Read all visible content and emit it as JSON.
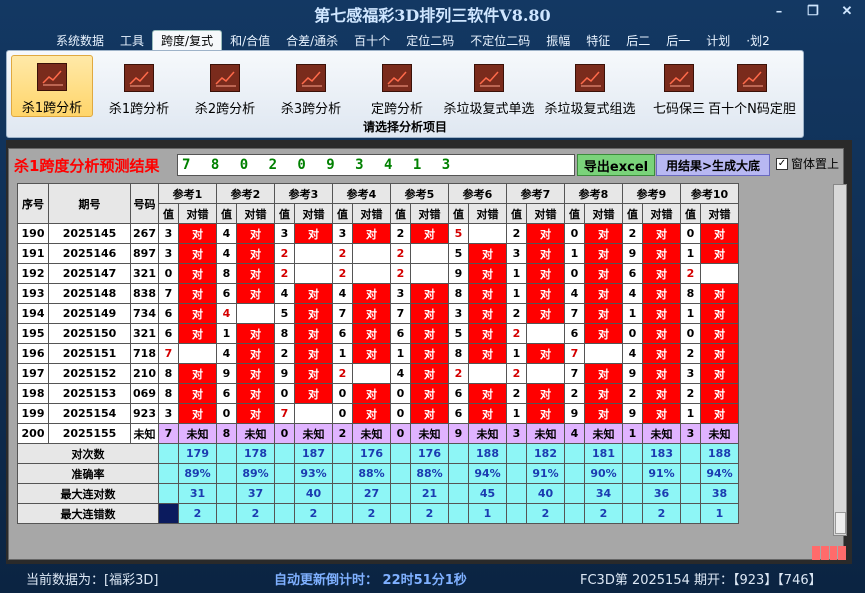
{
  "window": {
    "title": "第七感福彩3D排列三软件V8.80",
    "btn_min": "–",
    "btn_max": "❐",
    "btn_close": "✕"
  },
  "menu": [
    {
      "label": "系统数据",
      "active": false
    },
    {
      "label": "工具",
      "active": false
    },
    {
      "label": "跨度/复式",
      "active": true
    },
    {
      "label": "和/合值",
      "active": false
    },
    {
      "label": "合差/通杀",
      "active": false
    },
    {
      "label": "百十个",
      "active": false
    },
    {
      "label": "定位二码",
      "active": false
    },
    {
      "label": "不定位二码",
      "active": false
    },
    {
      "label": "振幅",
      "active": false
    },
    {
      "label": "特征",
      "active": false
    },
    {
      "label": "后二",
      "active": false
    },
    {
      "label": "后一",
      "active": false
    },
    {
      "label": "计划",
      "active": false
    },
    {
      "label": "·划2",
      "active": false
    }
  ],
  "ribbon": {
    "buttons": [
      {
        "label": "杀1跨分析",
        "selected": true,
        "icon": "chart-icon"
      },
      {
        "label": "杀1跨分析",
        "selected": false,
        "icon": "chart-icon"
      },
      {
        "label": "杀2跨分析",
        "selected": false,
        "icon": "chart-icon"
      },
      {
        "label": "杀3跨分析",
        "selected": false,
        "icon": "chart-icon"
      },
      {
        "label": "定跨分析",
        "selected": false,
        "icon": "chart-icon"
      },
      {
        "label": "杀垃圾复式单选",
        "selected": false,
        "icon": "chart-icon"
      },
      {
        "label": "杀垃圾复式组选",
        "selected": false,
        "icon": "chart-icon"
      },
      {
        "label": "七码保三",
        "selected": false,
        "icon": "chart-icon"
      },
      {
        "label": "百十个N码定胆",
        "selected": false,
        "icon": "chart-icon"
      }
    ],
    "caption": "请选择分析项目"
  },
  "result": {
    "title": "杀1跨度分析预测结果",
    "value": "7 8 0 2 0 9 3 4 1 3",
    "excel_btn": "导出excel",
    "gen_btn": "用结果>生成大底",
    "ontop_label": "窗体置上",
    "ontop_checked": "✓"
  },
  "table": {
    "headers": {
      "seq": "序号",
      "period": "期号",
      "num": "号码",
      "val": "值",
      "ok": "对错"
    },
    "refs": [
      "参考1",
      "参考2",
      "参考3",
      "参考4",
      "参考5",
      "参考6",
      "参考7",
      "参考8",
      "参考9",
      "参考10"
    ],
    "rows": [
      {
        "seq": "190",
        "period": "2025145",
        "num": "267",
        "cells": [
          [
            "3",
            "对"
          ],
          [
            "4",
            "对"
          ],
          [
            "3",
            "对"
          ],
          [
            "3",
            "对"
          ],
          [
            "2",
            "对"
          ],
          [
            "5",
            "",
            1
          ],
          [
            "2",
            "对"
          ],
          [
            "0",
            "对"
          ],
          [
            "2",
            "对"
          ],
          [
            "0",
            "对"
          ]
        ]
      },
      {
        "seq": "191",
        "period": "2025146",
        "num": "897",
        "cells": [
          [
            "3",
            "对"
          ],
          [
            "4",
            "对"
          ],
          [
            "2",
            "",
            1
          ],
          [
            "2",
            "",
            1
          ],
          [
            "2",
            "",
            1
          ],
          [
            "5",
            "对"
          ],
          [
            "3",
            "对"
          ],
          [
            "1",
            "对"
          ],
          [
            "9",
            "对"
          ],
          [
            "1",
            "对"
          ]
        ]
      },
      {
        "seq": "192",
        "period": "2025147",
        "num": "321",
        "cells": [
          [
            "0",
            "对"
          ],
          [
            "8",
            "对"
          ],
          [
            "2",
            "",
            1
          ],
          [
            "2",
            "",
            1
          ],
          [
            "2",
            "",
            1
          ],
          [
            "9",
            "对"
          ],
          [
            "1",
            "对"
          ],
          [
            "0",
            "对"
          ],
          [
            "6",
            "对"
          ],
          [
            "2",
            "",
            1
          ]
        ]
      },
      {
        "seq": "193",
        "period": "2025148",
        "num": "838",
        "cells": [
          [
            "7",
            "对"
          ],
          [
            "6",
            "对"
          ],
          [
            "4",
            "对"
          ],
          [
            "4",
            "对"
          ],
          [
            "3",
            "对"
          ],
          [
            "8",
            "对"
          ],
          [
            "1",
            "对"
          ],
          [
            "4",
            "对"
          ],
          [
            "4",
            "对"
          ],
          [
            "8",
            "对"
          ]
        ]
      },
      {
        "seq": "194",
        "period": "2025149",
        "num": "734",
        "cells": [
          [
            "6",
            "对"
          ],
          [
            "4",
            "",
            1
          ],
          [
            "5",
            "对"
          ],
          [
            "7",
            "对"
          ],
          [
            "7",
            "对"
          ],
          [
            "3",
            "对"
          ],
          [
            "2",
            "对"
          ],
          [
            "7",
            "对"
          ],
          [
            "1",
            "对"
          ],
          [
            "1",
            "对"
          ]
        ]
      },
      {
        "seq": "195",
        "period": "2025150",
        "num": "321",
        "cells": [
          [
            "6",
            "对"
          ],
          [
            "1",
            "对"
          ],
          [
            "8",
            "对"
          ],
          [
            "6",
            "对"
          ],
          [
            "6",
            "对"
          ],
          [
            "5",
            "对"
          ],
          [
            "2",
            "",
            1
          ],
          [
            "6",
            "对"
          ],
          [
            "0",
            "对"
          ],
          [
            "0",
            "对"
          ]
        ]
      },
      {
        "seq": "196",
        "period": "2025151",
        "num": "718",
        "cells": [
          [
            "7",
            "",
            1
          ],
          [
            "4",
            "对"
          ],
          [
            "2",
            "对"
          ],
          [
            "1",
            "对"
          ],
          [
            "1",
            "对"
          ],
          [
            "8",
            "对"
          ],
          [
            "1",
            "对"
          ],
          [
            "7",
            "",
            1
          ],
          [
            "4",
            "对"
          ],
          [
            "2",
            "对"
          ]
        ]
      },
      {
        "seq": "197",
        "period": "2025152",
        "num": "210",
        "cells": [
          [
            "8",
            "对"
          ],
          [
            "9",
            "对"
          ],
          [
            "9",
            "对"
          ],
          [
            "2",
            "",
            1
          ],
          [
            "4",
            "对"
          ],
          [
            "2",
            "",
            1
          ],
          [
            "2",
            "",
            1
          ],
          [
            "7",
            "对"
          ],
          [
            "9",
            "对"
          ],
          [
            "3",
            "对"
          ]
        ]
      },
      {
        "seq": "198",
        "period": "2025153",
        "num": "069",
        "cells": [
          [
            "8",
            "对"
          ],
          [
            "6",
            "对"
          ],
          [
            "0",
            "对"
          ],
          [
            "0",
            "对"
          ],
          [
            "0",
            "对"
          ],
          [
            "6",
            "对"
          ],
          [
            "2",
            "对"
          ],
          [
            "2",
            "对"
          ],
          [
            "2",
            "对"
          ],
          [
            "2",
            "对"
          ]
        ]
      },
      {
        "seq": "199",
        "period": "2025154",
        "num": "923",
        "cells": [
          [
            "3",
            "对"
          ],
          [
            "0",
            "对"
          ],
          [
            "7",
            "",
            1
          ],
          [
            "0",
            "对"
          ],
          [
            "0",
            "对"
          ],
          [
            "6",
            "对"
          ],
          [
            "1",
            "对"
          ],
          [
            "9",
            "对"
          ],
          [
            "9",
            "对"
          ],
          [
            "1",
            "对"
          ]
        ]
      },
      {
        "seq": "200",
        "period": "2025155",
        "num": "未知",
        "cells": [
          [
            "7",
            "未知"
          ],
          [
            "8",
            "未知"
          ],
          [
            "0",
            "未知"
          ],
          [
            "2",
            "未知"
          ],
          [
            "0",
            "未知"
          ],
          [
            "9",
            "未知"
          ],
          [
            "3",
            "未知"
          ],
          [
            "4",
            "未知"
          ],
          [
            "1",
            "未知"
          ],
          [
            "3",
            "未知"
          ]
        ]
      }
    ],
    "summary": [
      {
        "label": "对次数",
        "values": [
          "179",
          "178",
          "187",
          "176",
          "176",
          "188",
          "182",
          "181",
          "183",
          "188"
        ]
      },
      {
        "label": "准确率",
        "values": [
          "89%",
          "89%",
          "93%",
          "88%",
          "88%",
          "94%",
          "91%",
          "90%",
          "91%",
          "94%"
        ]
      },
      {
        "label": "最大连对数",
        "values": [
          "31",
          "37",
          "40",
          "27",
          "21",
          "45",
          "40",
          "34",
          "36",
          "38"
        ]
      },
      {
        "label": "最大连错数",
        "values": [
          "2",
          "2",
          "2",
          "2",
          "2",
          "1",
          "2",
          "2",
          "2",
          "1"
        ]
      }
    ]
  },
  "status": {
    "left": "当前数据为：[福彩3D]",
    "mid": "自动更新倒计时：  22时51分1秒",
    "right": "FC3D第 2025154 期开：【923】【746】"
  },
  "colors": {
    "red": "#ff0000",
    "cyan": "#8ef6f6",
    "unknown": "#e0b3ff",
    "brand": "#133863"
  }
}
